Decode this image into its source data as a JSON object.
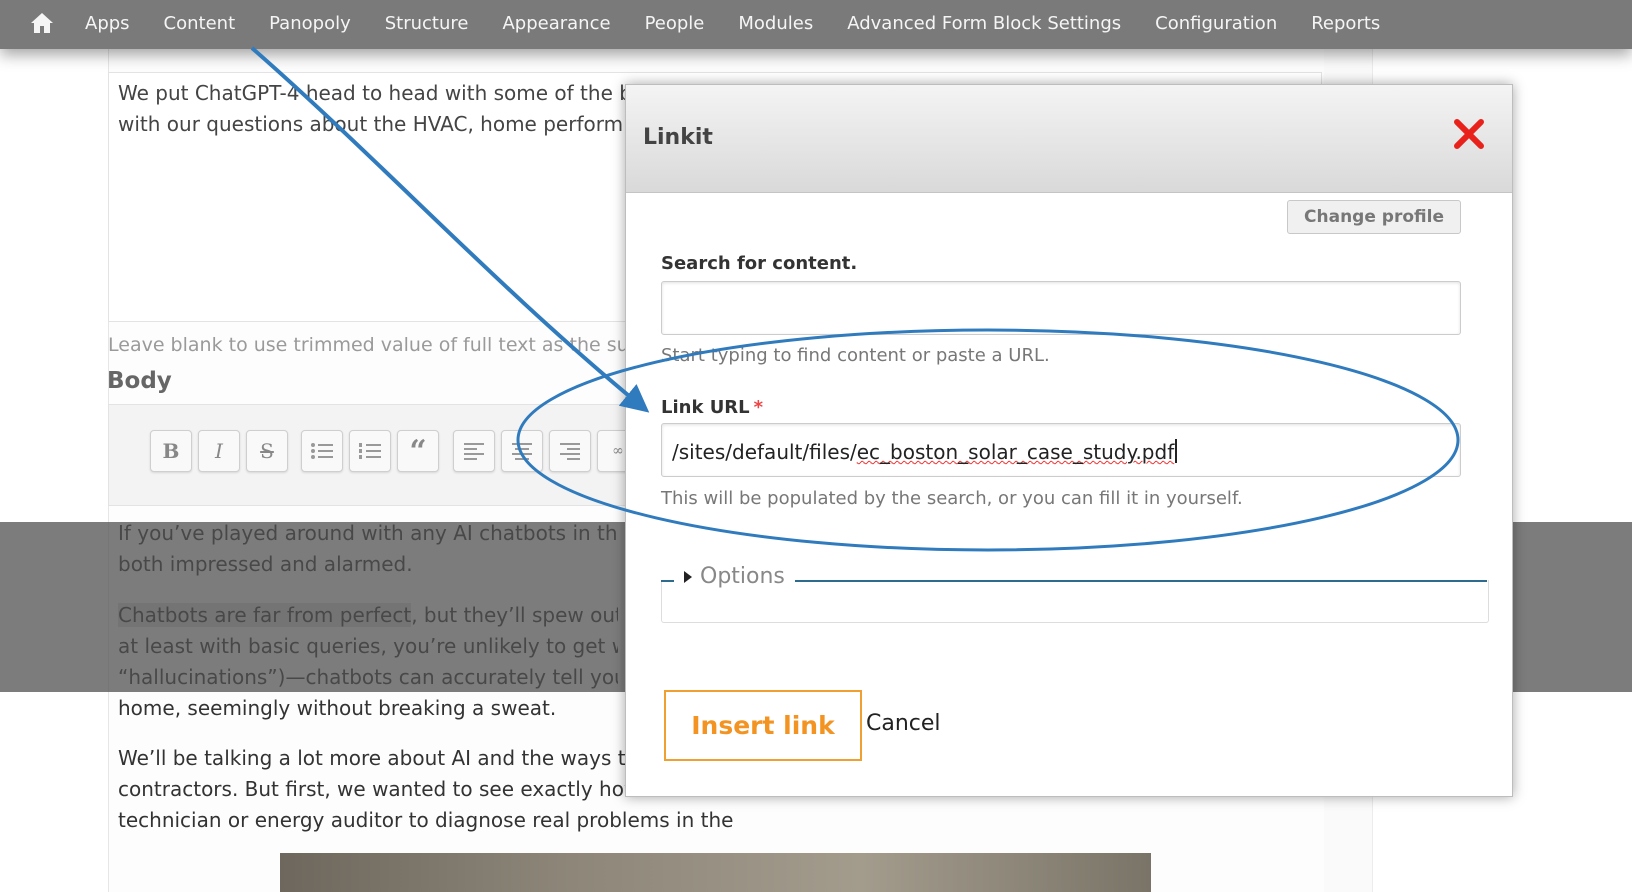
{
  "toolbar": {
    "home_icon": "home-icon",
    "items": [
      "Apps",
      "Content",
      "Panopoly",
      "Structure",
      "Appearance",
      "People",
      "Modules",
      "Advanced Form Block Settings",
      "Configuration",
      "Reports"
    ]
  },
  "background": {
    "summary_lines": [
      "We put ChatGPT-4 head to head with some of the b",
      "with our questions about the HVAC, home perform"
    ],
    "summary_help": "Leave blank to use trimmed value of full text as the su",
    "body_label": "Body",
    "editor_buttons": [
      "B",
      "I",
      "S"
    ],
    "body_paragraphs": [
      [
        "If you’ve played around with any AI chatbots in the",
        "both impressed and alarmed."
      ],
      [
        "Chatbots are far from perfect, but they’ll spew out",
        "at least with basic queries, you’re unlikely to get wi",
        "“hallucinations”)—chatbots can accurately tell you h",
        "home, seemingly without breaking a sweat."
      ],
      [
        "We’ll be talking a lot more about AI and the ways th",
        "contractors. But first, we wanted to see exactly how",
        "technician or energy auditor to diagnose real problems in the field?"
      ]
    ],
    "highlighted_phrase": "Chatbots are far from perfect"
  },
  "dialog": {
    "title": "Linkit",
    "close_icon": "close-icon",
    "change_profile": "Change profile",
    "search_label": "Search for content.",
    "search_value": "",
    "search_help": "Start typing to find content or paste a URL.",
    "url_label": "Link URL",
    "url_required": "*",
    "url_prefix": "/sites/default/files/",
    "url_misspelled": "ec_boston_solar_case_study.pdf",
    "url_help": "This will be populated by the search, or you can fill it in yourself.",
    "options_label": "Options",
    "insert_button": "Insert link",
    "cancel_link": "Cancel"
  },
  "colors": {
    "toolbar_bg": "#7a7a7a",
    "annotation_blue": "#2f7bbd",
    "insert_orange": "#f39322",
    "close_red": "#e8221b"
  }
}
